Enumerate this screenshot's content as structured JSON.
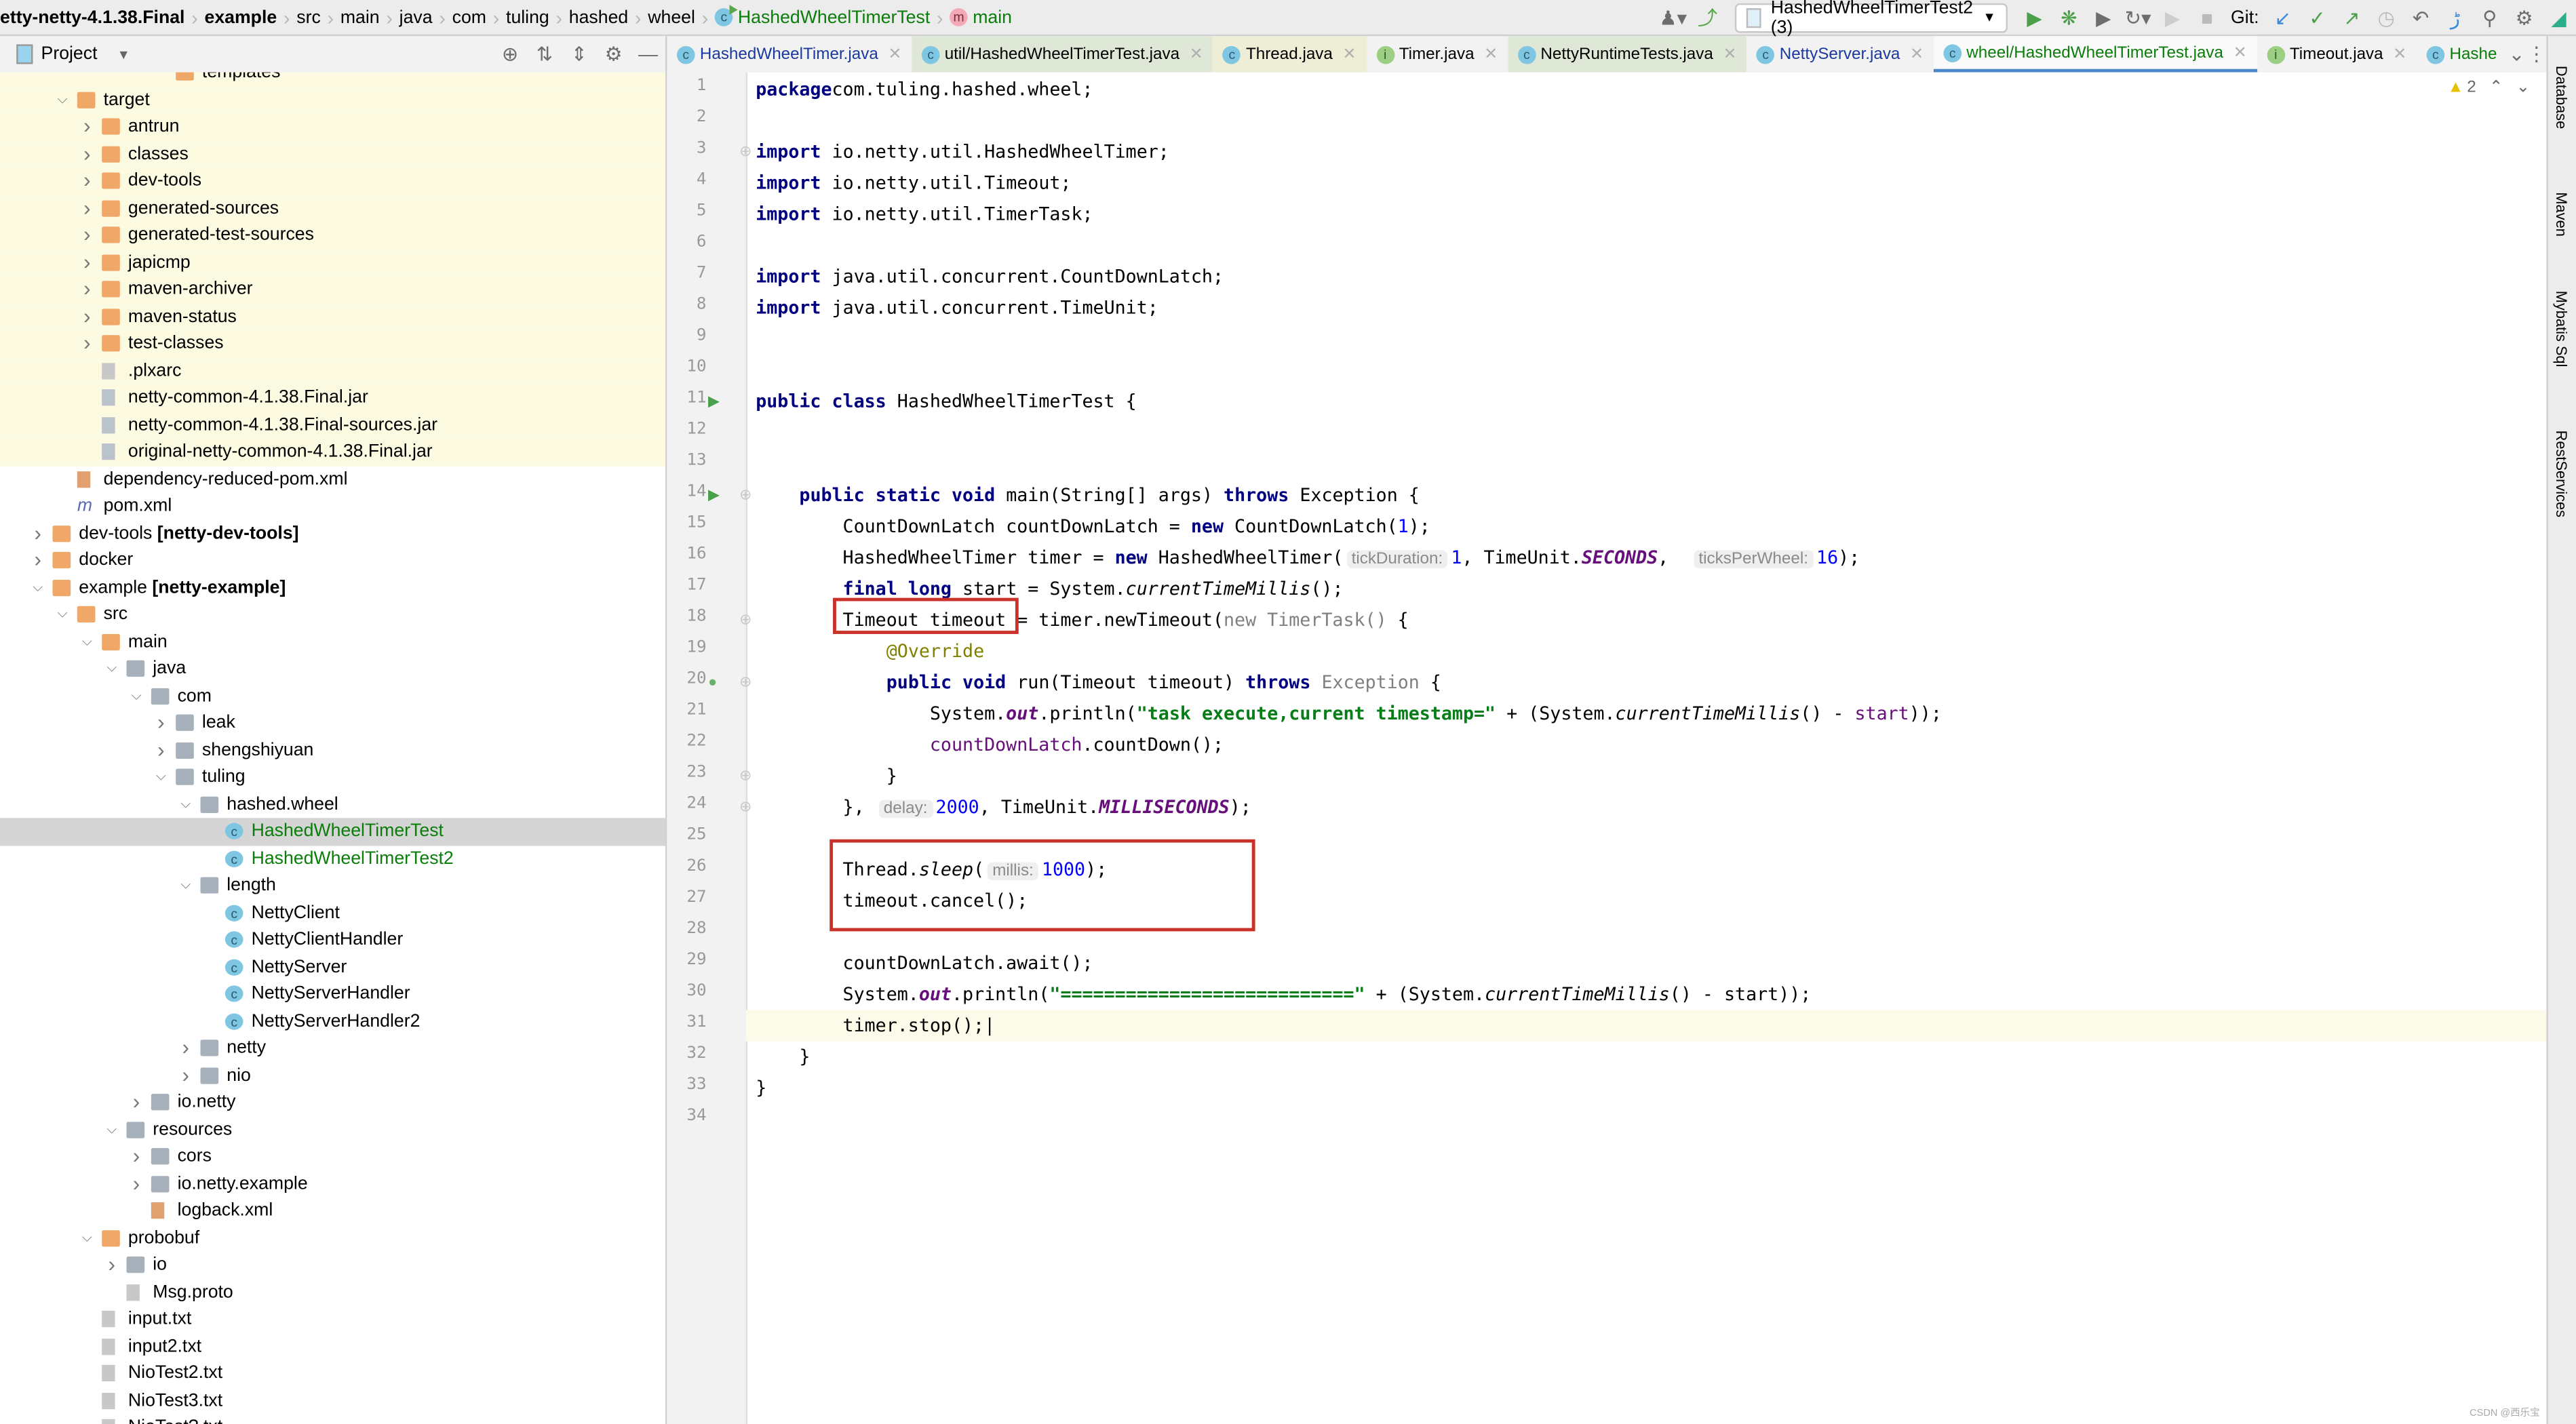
{
  "breadcrumb": [
    {
      "label": "etty-netty-4.1.38.Final",
      "bold": true
    },
    {
      "label": "example",
      "bold": true
    },
    {
      "label": "src"
    },
    {
      "label": "main"
    },
    {
      "label": "java"
    },
    {
      "label": "com"
    },
    {
      "label": "tuling"
    },
    {
      "label": "hashed"
    },
    {
      "label": "wheel"
    },
    {
      "label": "HashedWheelTimerTest",
      "icon": "class-icon",
      "color": "green"
    },
    {
      "label": "main",
      "icon": "method-icon",
      "color": "green"
    }
  ],
  "toolbar": {
    "run_config": "HashedWheelTimerTest2 (3)",
    "git_label": "Git:",
    "icons": [
      "user-icon",
      "build-hammer-icon",
      "run-icon",
      "debug-icon",
      "coverage-icon",
      "profile-icon",
      "stop-icon",
      "git-update-icon",
      "git-commit-icon",
      "git-push-icon",
      "history-icon",
      "rollback-icon",
      "translate-icon",
      "search-icon",
      "settings-icon",
      "plugin-icon"
    ]
  },
  "project": {
    "title": "Project",
    "tree": [
      {
        "label": "templates",
        "level": 6,
        "kind": "folder",
        "arrow": "",
        "ex": true,
        "y": -1
      },
      {
        "label": "target",
        "level": 2,
        "kind": "folder",
        "arrow": "down",
        "ex": true
      },
      {
        "label": "antrun",
        "level": 3,
        "kind": "folder",
        "arrow": "right",
        "ex": true
      },
      {
        "label": "classes",
        "level": 3,
        "kind": "folder",
        "arrow": "right",
        "ex": true
      },
      {
        "label": "dev-tools",
        "level": 3,
        "kind": "folder",
        "arrow": "right",
        "ex": true
      },
      {
        "label": "generated-sources",
        "level": 3,
        "kind": "folder",
        "arrow": "right",
        "ex": true
      },
      {
        "label": "generated-test-sources",
        "level": 3,
        "kind": "folder",
        "arrow": "right",
        "ex": true
      },
      {
        "label": "japicmp",
        "level": 3,
        "kind": "folder",
        "arrow": "right",
        "ex": true
      },
      {
        "label": "maven-archiver",
        "level": 3,
        "kind": "folder",
        "arrow": "right",
        "ex": true
      },
      {
        "label": "maven-status",
        "level": 3,
        "kind": "folder",
        "arrow": "right",
        "ex": true
      },
      {
        "label": "test-classes",
        "level": 3,
        "kind": "folder",
        "arrow": "right",
        "ex": true
      },
      {
        "label": ".plxarc",
        "level": 3,
        "kind": "file",
        "arrow": "",
        "ex": true
      },
      {
        "label": "netty-common-4.1.38.Final.jar",
        "level": 3,
        "kind": "jar",
        "arrow": "",
        "ex": true
      },
      {
        "label": "netty-common-4.1.38.Final-sources.jar",
        "level": 3,
        "kind": "jar",
        "arrow": "",
        "ex": true
      },
      {
        "label": "original-netty-common-4.1.38.Final.jar",
        "level": 3,
        "kind": "jar",
        "arrow": "",
        "ex": true
      },
      {
        "label": "dependency-reduced-pom.xml",
        "level": 2,
        "kind": "xml",
        "arrow": ""
      },
      {
        "label": "pom.xml",
        "level": 2,
        "kind": "maven",
        "arrow": ""
      },
      {
        "label": "dev-tools [netty-dev-tools]",
        "level": 1,
        "kind": "module",
        "arrow": "right",
        "bold": true
      },
      {
        "label": "docker",
        "level": 1,
        "kind": "folder",
        "arrow": "right"
      },
      {
        "label": "example [netty-example]",
        "level": 1,
        "kind": "module",
        "arrow": "down",
        "bold": true
      },
      {
        "label": "src",
        "level": 2,
        "kind": "folder",
        "arrow": "down"
      },
      {
        "label": "main",
        "level": 3,
        "kind": "folder",
        "arrow": "down"
      },
      {
        "label": "java",
        "level": 4,
        "kind": "srcfolder",
        "arrow": "down"
      },
      {
        "label": "com",
        "level": 5,
        "kind": "package",
        "arrow": "down"
      },
      {
        "label": "leak",
        "level": 6,
        "kind": "package",
        "arrow": "right"
      },
      {
        "label": "shengshiyuan",
        "level": 6,
        "kind": "package",
        "arrow": "right"
      },
      {
        "label": "tuling",
        "level": 6,
        "kind": "package",
        "arrow": "down"
      },
      {
        "label": "hashed.wheel",
        "level": 7,
        "kind": "package",
        "arrow": "down"
      },
      {
        "label": "HashedWheelTimerTest",
        "level": 8,
        "kind": "class",
        "arrow": "",
        "color": "green",
        "sel": true
      },
      {
        "label": "HashedWheelTimerTest2",
        "level": 8,
        "kind": "class",
        "arrow": "",
        "color": "green"
      },
      {
        "label": "length",
        "level": 7,
        "kind": "package",
        "arrow": "down"
      },
      {
        "label": "NettyClient",
        "level": 8,
        "kind": "class",
        "arrow": ""
      },
      {
        "label": "NettyClientHandler",
        "level": 8,
        "kind": "class",
        "arrow": ""
      },
      {
        "label": "NettyServer",
        "level": 8,
        "kind": "class",
        "arrow": ""
      },
      {
        "label": "NettyServerHandler",
        "level": 8,
        "kind": "class",
        "arrow": ""
      },
      {
        "label": "NettyServerHandler2",
        "level": 8,
        "kind": "class",
        "arrow": ""
      },
      {
        "label": "netty",
        "level": 7,
        "kind": "package",
        "arrow": "right"
      },
      {
        "label": "nio",
        "level": 7,
        "kind": "package",
        "arrow": "right"
      },
      {
        "label": "io.netty",
        "level": 5,
        "kind": "package",
        "arrow": "right"
      },
      {
        "label": "resources",
        "level": 4,
        "kind": "srcfolder",
        "arrow": "down"
      },
      {
        "label": "cors",
        "level": 5,
        "kind": "package",
        "arrow": "right"
      },
      {
        "label": "io.netty.example",
        "level": 5,
        "kind": "package",
        "arrow": "right"
      },
      {
        "label": "logback.xml",
        "level": 5,
        "kind": "xml",
        "arrow": ""
      },
      {
        "label": "probobuf",
        "level": 3,
        "kind": "folder",
        "arrow": "down"
      },
      {
        "label": "io",
        "level": 4,
        "kind": "package",
        "arrow": "right"
      },
      {
        "label": "Msg.proto",
        "level": 4,
        "kind": "proto",
        "arrow": ""
      },
      {
        "label": "input.txt",
        "level": 3,
        "kind": "file",
        "arrow": ""
      },
      {
        "label": "input2.txt",
        "level": 3,
        "kind": "file",
        "arrow": ""
      },
      {
        "label": "NioTest2.txt",
        "level": 3,
        "kind": "file",
        "arrow": ""
      },
      {
        "label": "NioTest3.txt",
        "level": 3,
        "kind": "file",
        "arrow": ""
      },
      {
        "label": "NioTest?.txt",
        "level": 3,
        "kind": "file",
        "arrow": ""
      }
    ]
  },
  "tabs": [
    {
      "label": "HashedWheelTimer.java",
      "icon": "C",
      "color": "#1a3aa0",
      "bg": ""
    },
    {
      "label": "util/HashedWheelTimerTest.java",
      "icon": "C",
      "color": "#000",
      "bg": "#dfe8d6"
    },
    {
      "label": "Thread.java",
      "icon": "C",
      "color": "#000",
      "bg": "#eeeed6"
    },
    {
      "label": "Timer.java",
      "icon": "I",
      "color": "#000",
      "bg": ""
    },
    {
      "label": "NettyRuntimeTests.java",
      "icon": "C",
      "color": "#000",
      "bg": "#dfe8d6"
    },
    {
      "label": "NettyServer.java",
      "icon": "C",
      "color": "#1a3aa0",
      "bg": ""
    },
    {
      "label": "wheel/HashedWheelTimerTest.java",
      "icon": "C",
      "color": "#0a7d0a",
      "bg": "",
      "active": true
    },
    {
      "label": "Timeout.java",
      "icon": "I",
      "color": "#000",
      "bg": ""
    },
    {
      "label": "Hashe",
      "icon": "C",
      "color": "#0a7d0a",
      "bg": "",
      "noclose": true
    }
  ],
  "editor": {
    "warnings": "2",
    "current_line": 31,
    "lines": [
      [
        [
          "kw",
          "package"
        ],
        [
          "",
          "com.tuling.hashed.wheel;"
        ]
      ],
      [],
      [
        [
          "kw",
          "import"
        ],
        [
          "",
          " io.netty.util.HashedWheelTimer;"
        ]
      ],
      [
        [
          "kw",
          "import"
        ],
        [
          "",
          " io.netty.util.Timeout;"
        ]
      ],
      [
        [
          "kw",
          "import"
        ],
        [
          "",
          " io.netty.util.TimerTask;"
        ]
      ],
      [],
      [
        [
          "kw",
          "import"
        ],
        [
          "",
          " java.util.concurrent.CountDownLatch;"
        ]
      ],
      [
        [
          "kw",
          "import"
        ],
        [
          "",
          " java.util.concurrent.TimeUnit;"
        ]
      ],
      [],
      [],
      [
        [
          "kw",
          "public class"
        ],
        [
          "",
          " HashedWheelTimerTest {"
        ]
      ],
      [],
      [],
      [
        [
          "",
          "    "
        ],
        [
          "kw",
          "public static void"
        ],
        [
          "",
          " main(String[] args) "
        ],
        [
          "kw",
          "throws"
        ],
        [
          "",
          " Exception {"
        ]
      ],
      [
        [
          "",
          "        CountDownLatch countDownLatch = "
        ],
        [
          "kw",
          "new"
        ],
        [
          "",
          " CountDownLatch("
        ],
        [
          "num",
          "1"
        ],
        [
          "",
          ");"
        ]
      ],
      [
        [
          "",
          "        HashedWheelTimer timer = "
        ],
        [
          "kw",
          "new"
        ],
        [
          "",
          " HashedWheelTimer("
        ],
        [
          "hint",
          "tickDuration:"
        ],
        [
          "num",
          "1"
        ],
        [
          "",
          ", TimeUnit."
        ],
        [
          "field",
          "SECONDS"
        ],
        [
          "",
          ",  "
        ],
        [
          "hint",
          "ticksPerWheel:"
        ],
        [
          "num",
          "16"
        ],
        [
          "",
          ");"
        ]
      ],
      [
        [
          "",
          "        "
        ],
        [
          "kw",
          "final long"
        ],
        [
          "",
          " start = System."
        ],
        [
          "static",
          "currentTimeMillis"
        ],
        [
          "",
          "();"
        ]
      ],
      [
        [
          "",
          "        Timeout timeout = timer.newTimeout("
        ],
        [
          "grey",
          "new TimerTask() "
        ],
        [
          "",
          "{"
        ]
      ],
      [
        [
          "",
          "            "
        ],
        [
          "anno",
          "@Override"
        ]
      ],
      [
        [
          "",
          "            "
        ],
        [
          "kw",
          "public void"
        ],
        [
          "",
          " run(Timeout timeout) "
        ],
        [
          "kw",
          "throws"
        ],
        [
          "grey",
          " Exception "
        ],
        [
          "",
          "{"
        ]
      ],
      [
        [
          "",
          "                System."
        ],
        [
          "field",
          "out"
        ],
        [
          "",
          ".println("
        ],
        [
          "str",
          "\"task execute,current timestamp=\""
        ],
        [
          "",
          " + (System."
        ],
        [
          "static",
          "currentTimeMillis"
        ],
        [
          "",
          "() - "
        ],
        [
          "local",
          "start"
        ],
        [
          "",
          "));"
        ]
      ],
      [
        [
          "",
          "                "
        ],
        [
          "local",
          "countDownLatch"
        ],
        [
          "",
          ".countDown();"
        ]
      ],
      [
        [
          "",
          "            }"
        ]
      ],
      [
        [
          "",
          "        }, "
        ],
        [
          "hint",
          "delay:"
        ],
        [
          "num",
          "2000"
        ],
        [
          "",
          ", TimeUnit."
        ],
        [
          "field",
          "MILLISECONDS"
        ],
        [
          "",
          ");"
        ]
      ],
      [],
      [
        [
          "",
          "        Thread."
        ],
        [
          "static",
          "sleep"
        ],
        [
          "",
          "("
        ],
        [
          "hint",
          "millis:"
        ],
        [
          "num",
          "1000"
        ],
        [
          "",
          ");"
        ]
      ],
      [
        [
          "",
          "        timeout.cancel();"
        ]
      ],
      [],
      [
        [
          "",
          "        countDownLatch.await();"
        ]
      ],
      [
        [
          "",
          "        System."
        ],
        [
          "field",
          "out"
        ],
        [
          "",
          ".println("
        ],
        [
          "str",
          "\"===========================\""
        ],
        [
          "",
          " + (System."
        ],
        [
          "static",
          "currentTimeMillis"
        ],
        [
          "",
          "() - start));"
        ]
      ],
      [
        [
          "",
          "        timer.stop();"
        ]
      ],
      [
        [
          "",
          "    }"
        ]
      ],
      [
        [
          "",
          "}"
        ]
      ],
      []
    ]
  },
  "right_tools": [
    "Database",
    "Maven",
    "Mybatis Sql",
    "RestServices"
  ],
  "watermark": "CSDN @西乐宝"
}
